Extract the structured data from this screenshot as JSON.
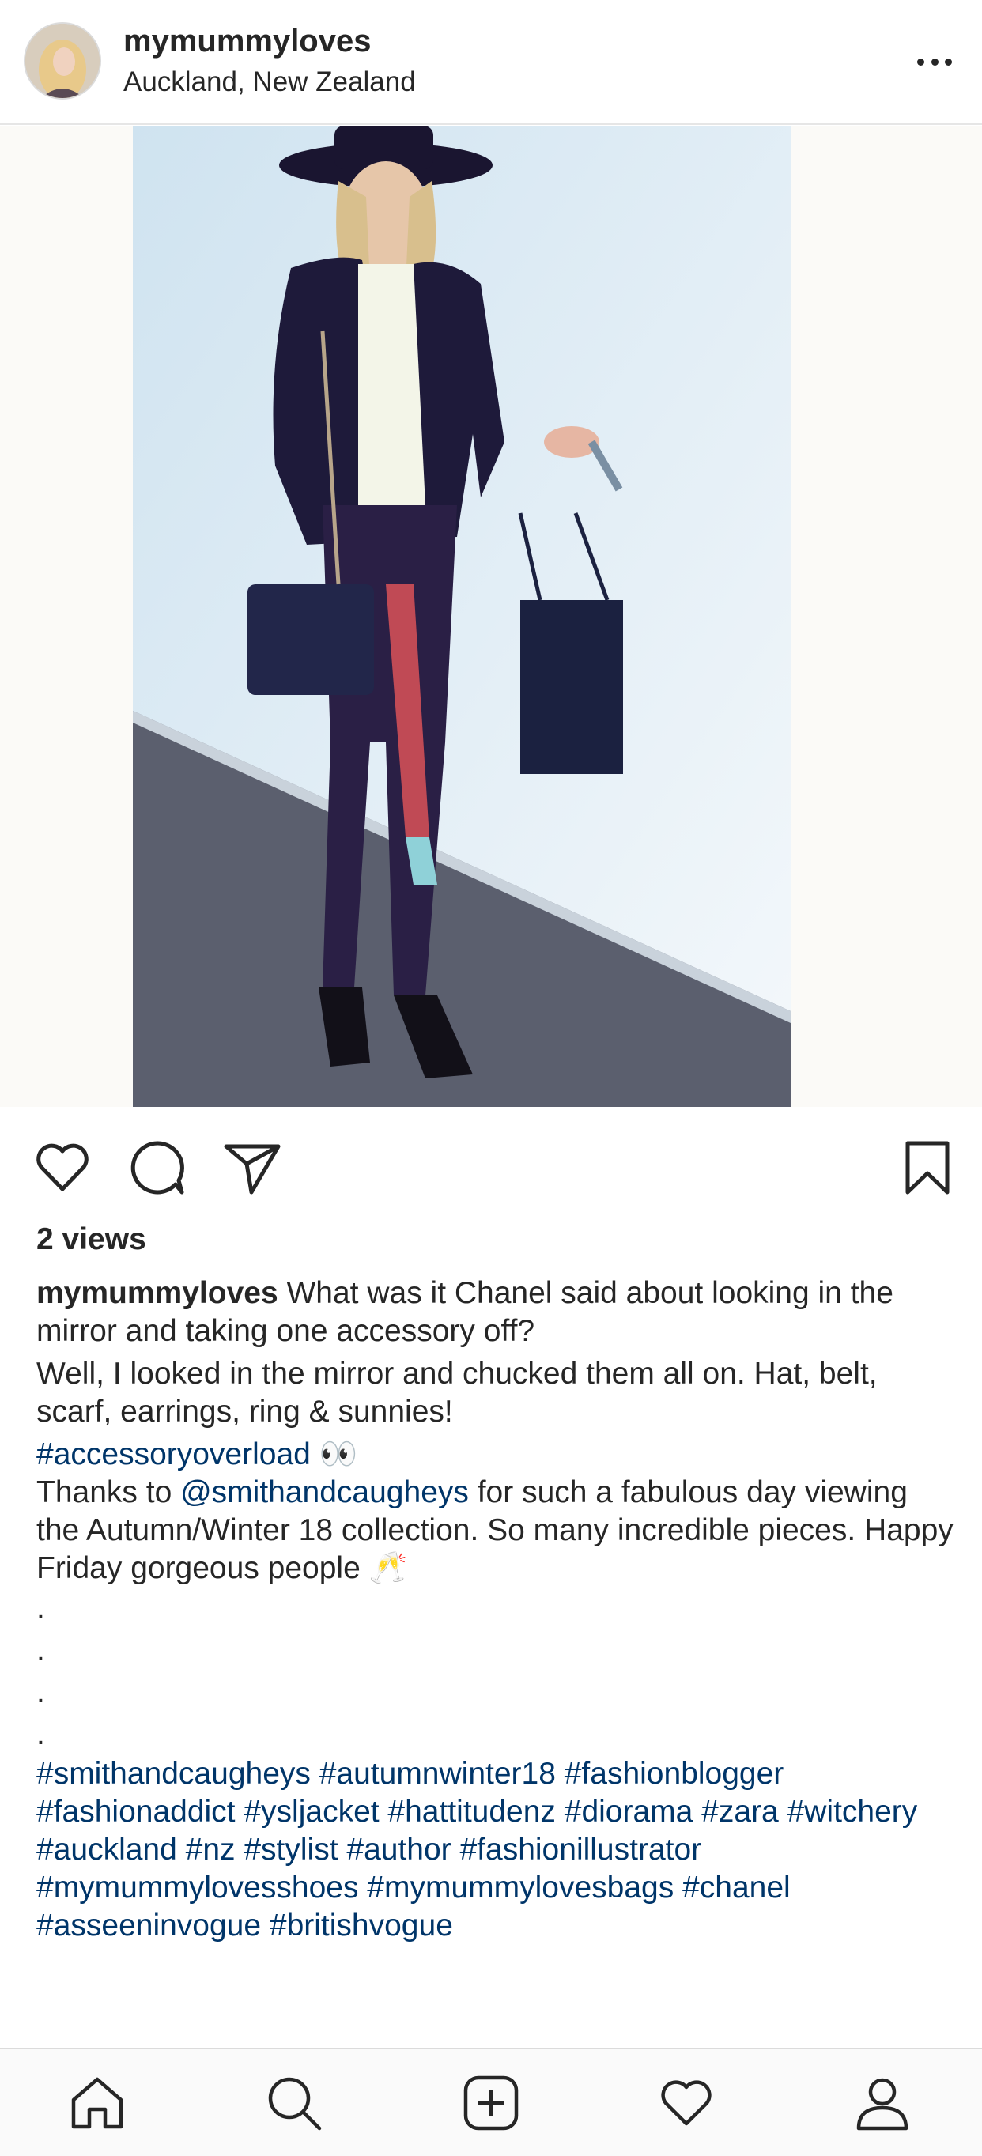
{
  "header": {
    "username": "mymummyloves",
    "location": "Auckland, New Zealand"
  },
  "post": {
    "views": "2 views",
    "caption_user": "mymummyloves",
    "caption_line1": " What was it Chanel said about looking in the mirror and taking one accessory off?",
    "caption_line2": "Well, I looked in the mirror and chucked them all on. Hat, belt, scarf, earrings, ring & sunnies!",
    "hashtag_line": "#accessoryoverload",
    "hashtag_emoji": " 👀",
    "thanks_prefix": "Thanks to ",
    "mention": "@smithandcaugheys",
    "thanks_suffix": " for such a fabulous day viewing the Autumn/Winter 18 collection. So many incredible pieces. Happy Friday gorgeous people 🥂",
    "dots": [
      ".",
      ".",
      ".",
      "."
    ],
    "hashtags": "#smithandcaugheys #autumnwinter18 #fashionblogger #fashionaddict #ysljacket #hattitudenz #diorama #zara #witchery #auckland #nz #stylist #author #fashionillustrator #mymummylovesshoes #mymummylovesbags #chanel #asseeninvogue #britishvogue"
  },
  "icons": {
    "more": "more-horizontal-icon",
    "like": "heart-icon",
    "comment": "comment-icon",
    "share": "paper-plane-icon",
    "save": "bookmark-icon",
    "tabs": [
      "home-icon",
      "search-icon",
      "add-post-icon",
      "activity-heart-icon",
      "profile-icon"
    ]
  },
  "colors": {
    "link": "#003569",
    "text": "#262626",
    "divider": "#dbdbdb"
  }
}
